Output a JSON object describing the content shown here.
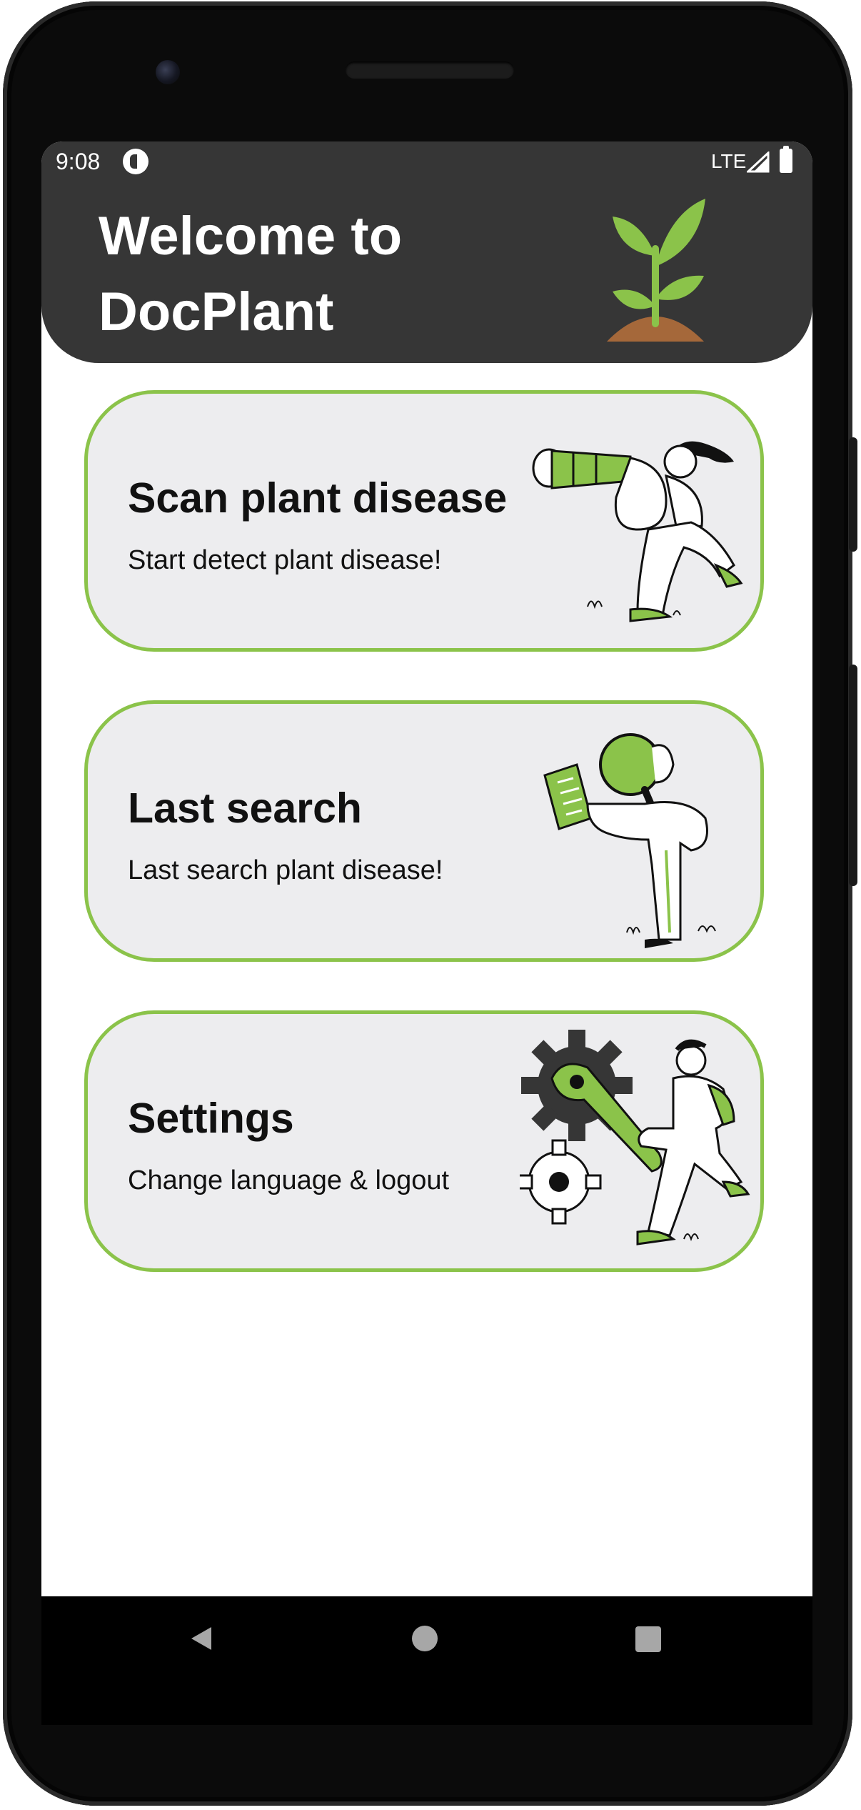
{
  "status_bar": {
    "time": "9:08",
    "network": "LTE",
    "icons": [
      "app-notification-icon",
      "signal-icon",
      "battery-icon"
    ]
  },
  "header": {
    "title_line1": "Welcome to",
    "title_line2": "DocPlant",
    "logo_icon": "sprout-icon",
    "background_color": "#363636"
  },
  "cards": [
    {
      "title": "Scan plant disease",
      "subtitle": "Start detect plant disease!",
      "illustration": "person-with-telescope-illustration"
    },
    {
      "title": "Last search",
      "subtitle": "Last search plant disease!",
      "illustration": "person-with-magnifier-illustration"
    },
    {
      "title": "Settings",
      "subtitle": "Change language & logout",
      "illustration": "person-with-gears-wrench-illustration"
    }
  ],
  "colors": {
    "accent_green": "#8bc34a",
    "card_background": "#ededef",
    "text": "#111111"
  },
  "nav_bar": {
    "buttons": [
      "back-icon",
      "home-icon",
      "recent-apps-icon"
    ]
  }
}
